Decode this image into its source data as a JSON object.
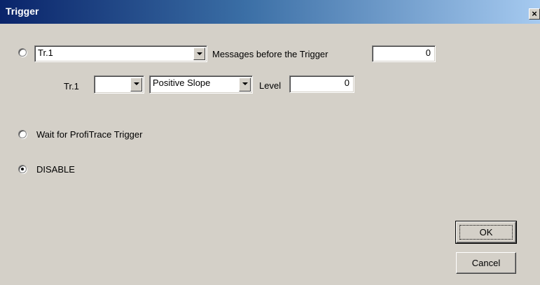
{
  "window": {
    "title": "Trigger",
    "close_glyph": "×"
  },
  "trigger_option": {
    "channel_value": "Tr.1",
    "messages_label": "Messages before the Trigger",
    "messages_value": "0",
    "sub_channel_label": "Tr.1",
    "sub_channel_value": "",
    "slope_value": "Positive Slope",
    "level_label": "Level",
    "level_value": "0",
    "selected": false
  },
  "profitrace_option": {
    "label": "Wait for ProfiTrace Trigger",
    "selected": false
  },
  "disable_option": {
    "label": "DISABLE",
    "selected": true
  },
  "buttons": {
    "ok": "OK",
    "cancel": "Cancel"
  },
  "icons": {
    "dropdown": "chevron-down-icon",
    "close": "close-icon"
  }
}
